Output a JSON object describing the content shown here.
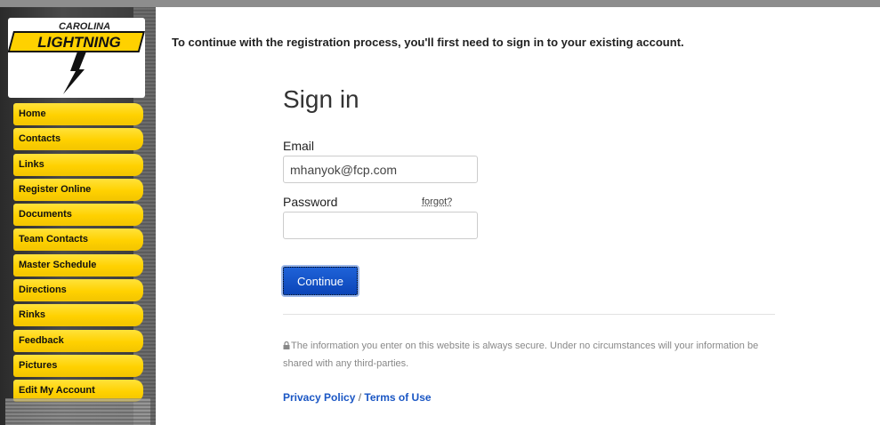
{
  "logo": {
    "line1": "CAROLINA",
    "line2": "LIGHTNING"
  },
  "nav": {
    "items": [
      {
        "label": "Home"
      },
      {
        "label": "Contacts"
      },
      {
        "label": "Links"
      },
      {
        "label": "Register Online"
      },
      {
        "label": "Documents"
      },
      {
        "label": "Team Contacts"
      },
      {
        "label": "Master Schedule"
      },
      {
        "label": "Directions"
      },
      {
        "label": "Rinks"
      },
      {
        "label": "Feedback"
      },
      {
        "label": "Pictures"
      },
      {
        "label": "Edit My Account"
      }
    ]
  },
  "main": {
    "intro": "To continue with the registration process, you'll first need to sign in to your existing account.",
    "title": "Sign in",
    "email_label": "Email",
    "email_value": "mhanyok@fcp.com",
    "password_label": "Password",
    "password_value": "",
    "forgot_label": "forgot?",
    "continue_label": "Continue",
    "secure_text": "The information you enter on this website is always secure. Under no circumstances will your information be shared with any third-parties.",
    "privacy_label": "Privacy Policy",
    "separator": "/",
    "terms_label": "Terms of Use"
  },
  "colors": {
    "nav_yellow": "#ffd100",
    "button_blue": "#0b45b8",
    "link_blue": "#1a56c4"
  }
}
